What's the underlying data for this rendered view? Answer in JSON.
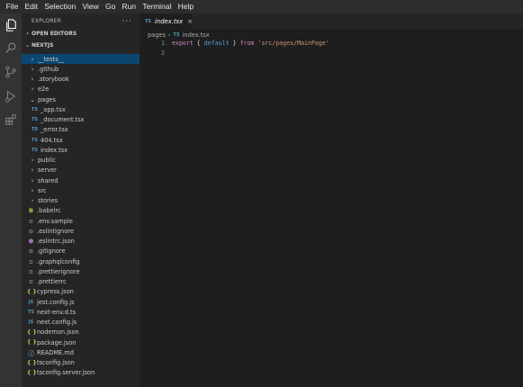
{
  "menu": [
    "File",
    "Edit",
    "Selection",
    "View",
    "Go",
    "Run",
    "Terminal",
    "Help"
  ],
  "activity": [
    "explorer-icon",
    "search-icon",
    "source-control-icon",
    "run-debug-icon",
    "extensions-icon"
  ],
  "sidebar": {
    "title": "EXPLORER",
    "more": "···",
    "open_editors": "OPEN EDITORS",
    "project": "NEXTJS"
  },
  "tree": [
    {
      "label": "__tests__",
      "kind": "folder",
      "indent": 0,
      "selected": true
    },
    {
      "label": ".github",
      "kind": "folder",
      "indent": 0
    },
    {
      "label": ".storybook",
      "kind": "folder",
      "indent": 0
    },
    {
      "label": "e2e",
      "kind": "folder",
      "indent": 0
    },
    {
      "label": "pages",
      "kind": "folder-open",
      "indent": 0
    },
    {
      "label": "_app.tsx",
      "kind": "ts",
      "indent": 1
    },
    {
      "label": "_document.tsx",
      "kind": "ts",
      "indent": 1
    },
    {
      "label": "_error.tsx",
      "kind": "ts",
      "indent": 1
    },
    {
      "label": "404.tsx",
      "kind": "ts",
      "indent": 1
    },
    {
      "label": "index.tsx",
      "kind": "ts",
      "indent": 1
    },
    {
      "label": "public",
      "kind": "folder",
      "indent": 0
    },
    {
      "label": "server",
      "kind": "folder",
      "indent": 0
    },
    {
      "label": "shared",
      "kind": "folder",
      "indent": 0
    },
    {
      "label": "src",
      "kind": "folder",
      "indent": 0
    },
    {
      "label": "stories",
      "kind": "folder",
      "indent": 0
    },
    {
      "label": ".babelrc",
      "kind": "babel",
      "indent": 0
    },
    {
      "label": ".env.sample",
      "kind": "cfg",
      "indent": 0
    },
    {
      "label": ".eslintignore",
      "kind": "circle",
      "indent": 0
    },
    {
      "label": ".eslintrc.json",
      "kind": "eslint",
      "indent": 0
    },
    {
      "label": ".gitignore",
      "kind": "circle",
      "indent": 0
    },
    {
      "label": ".graphqlconfig",
      "kind": "cfg",
      "indent": 0
    },
    {
      "label": ".prettierignore",
      "kind": "cfg",
      "indent": 0
    },
    {
      "label": ".prettierrc",
      "kind": "cfg",
      "indent": 0
    },
    {
      "label": "cypress.json",
      "kind": "json",
      "indent": 0
    },
    {
      "label": "jest.config.js",
      "kind": "js",
      "indent": 0
    },
    {
      "label": "next-env.d.ts",
      "kind": "ts",
      "indent": 0
    },
    {
      "label": "next.config.js",
      "kind": "js",
      "indent": 0
    },
    {
      "label": "nodemon.json",
      "kind": "json",
      "indent": 0
    },
    {
      "label": "package.json",
      "kind": "json",
      "indent": 0
    },
    {
      "label": "README.md",
      "kind": "info",
      "indent": 0
    },
    {
      "label": "tsconfig.json",
      "kind": "json",
      "indent": 0
    },
    {
      "label": "tsconfig.server.json",
      "kind": "json",
      "indent": 0
    }
  ],
  "tab": {
    "badge": "TS",
    "name": "index.tsx",
    "close": "×"
  },
  "breadcrumb": {
    "folder": "pages",
    "sep": "›",
    "badge": "TS",
    "file": "index.tsx"
  },
  "code": {
    "line1_no": "1",
    "line2_no": "2",
    "tokens": {
      "export": "export",
      "lbrace": " { ",
      "default": "default",
      "rbrace": " } ",
      "from": "from",
      "space": " ",
      "path": "'src/pages/MainPage'"
    }
  },
  "colors": {
    "accent_selected": "#094771",
    "ts_icon": "#519aba",
    "json_icon": "#cbcb41",
    "keyword": "#c586c0",
    "keyword_blue": "#569cd6",
    "string": "#ce9178"
  }
}
